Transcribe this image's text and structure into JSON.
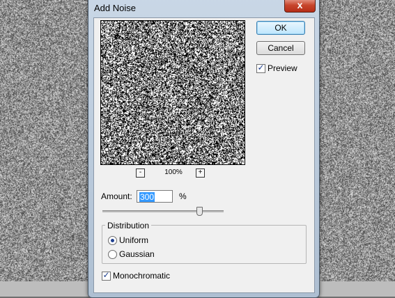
{
  "dialog": {
    "title": "Add Noise",
    "close_glyph": "x",
    "ok_label": "OK",
    "cancel_label": "Cancel",
    "preview_label": "Preview",
    "preview_checked": true,
    "zoom_out_label": "-",
    "zoom_in_label": "+",
    "zoom_value": "100%",
    "amount_label": "Amount:",
    "amount_value": "300",
    "amount_unit": "%",
    "amount_slider_fraction": 0.8,
    "distribution_label": "Distribution",
    "distribution_options": [
      {
        "label": "Uniform",
        "selected": true
      },
      {
        "label": "Gaussian",
        "selected": false
      }
    ],
    "monochromatic_label": "Monochromatic",
    "monochromatic_checked": true
  }
}
